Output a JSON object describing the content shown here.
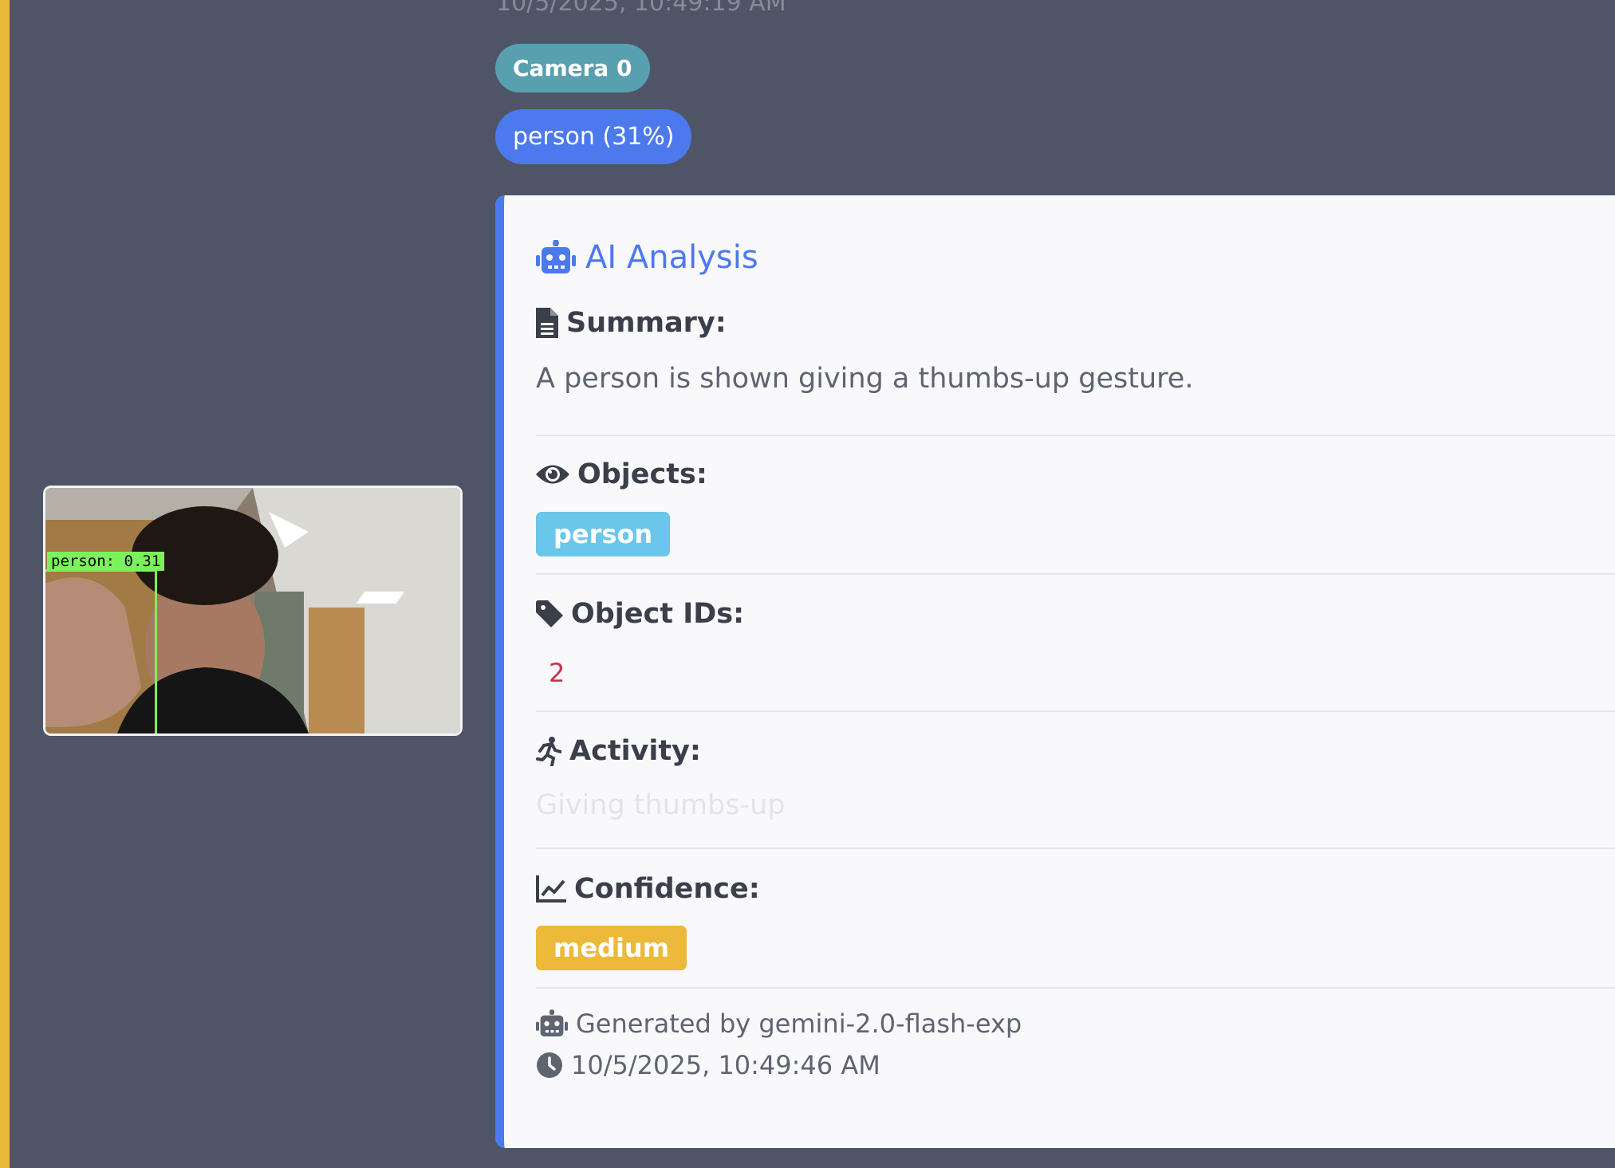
{
  "event": {
    "timestamp": "10/5/2025, 10:49:19 AM",
    "camera_label": "Camera 0",
    "detection_label": "person (31%)"
  },
  "thumbnail": {
    "bbox_label": "person: 0.31"
  },
  "analysis": {
    "title": "AI Analysis",
    "summary_heading": "Summary:",
    "summary_text": "A person is shown giving a thumbs-up gesture.",
    "objects_heading": "Objects:",
    "objects": [
      "person"
    ],
    "object_ids_heading": "Object IDs:",
    "object_ids": [
      "2"
    ],
    "activity_heading": "Activity:",
    "activity_text": "Giving thumbs-up",
    "confidence_heading": "Confidence:",
    "confidence_value": "medium",
    "generated_by": "Generated by gemini-2.0-flash-exp",
    "generated_at": "10/5/2025, 10:49:46 AM"
  },
  "icons": {
    "title": "robot-icon",
    "summary": "file-lines-icon",
    "objects": "eye-icon",
    "object_ids": "tag-icon",
    "activity": "running-person-icon",
    "confidence": "line-chart-icon",
    "generated_by": "robot-icon",
    "generated_at": "clock-icon"
  },
  "colors": {
    "page_background": "#4f5566",
    "left_accent": "#e9b93a",
    "camera_badge": "#58a0b0",
    "detection_badge": "#4d79ee",
    "card_accent": "#4d79ee",
    "object_chip": "#6ac6ea",
    "confidence_chip": "#ecb93a",
    "object_id_text": "#c7314e",
    "bbox": "#7bf25c"
  }
}
